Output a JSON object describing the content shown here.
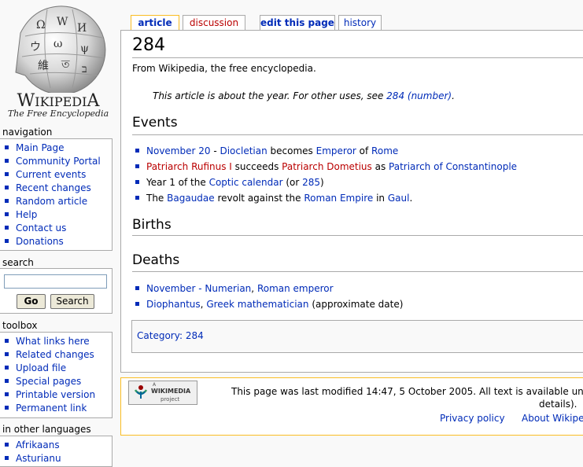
{
  "logo": {
    "wordmark_big1": "W",
    "wordmark_small1": "IKIPEDI",
    "wordmark_big2": "A",
    "tagline": "The Free Encyclopedia"
  },
  "navigation": {
    "heading": "navigation",
    "items": [
      "Main Page",
      "Community Portal",
      "Current events",
      "Recent changes",
      "Random article",
      "Help",
      "Contact us",
      "Donations"
    ]
  },
  "search": {
    "heading": "search",
    "value": "",
    "go_label": "Go",
    "search_label": "Search"
  },
  "toolbox": {
    "heading": "toolbox",
    "items": [
      "What links here",
      "Related changes",
      "Upload file",
      "Special pages",
      "Printable version",
      "Permanent link"
    ]
  },
  "languages": {
    "heading": "in other languages",
    "items": [
      "Afrikaans",
      "Asturianu"
    ]
  },
  "tabs": {
    "article": "article",
    "discussion": "discussion",
    "edit": "edit this page",
    "history": "history"
  },
  "article": {
    "title": "284",
    "subtitle": "From Wikipedia, the free encyclopedia.",
    "dablink": {
      "pre": "This article is about the year. For other uses, see ",
      "link": "284 (number)",
      "post": "."
    },
    "events_heading": "Events",
    "events": [
      {
        "a": "November 20",
        "b": " - ",
        "c": "Diocletian",
        "d": " becomes ",
        "e": "Emperor",
        "f": " of ",
        "g": "Rome"
      },
      {
        "a": "Patriarch Rufinus I",
        "b": " succeeds ",
        "c": "Patriarch Dometius",
        "d": " as ",
        "e": "Patriarch of Constantinople"
      },
      {
        "a": "Year 1 of the ",
        "b": "Coptic calendar",
        "c": " (or ",
        "d": "285",
        "e": ")"
      },
      {
        "a": "The ",
        "b": "Bagaudae",
        "c": " revolt against the ",
        "d": "Roman Empire",
        "e": " in ",
        "f": "Gaul",
        "g": "."
      }
    ],
    "births_heading": "Births",
    "deaths_heading": "Deaths",
    "deaths": [
      {
        "a": "November",
        "b": " - ",
        "c": "Numerian",
        "d": ", ",
        "e": "Roman emperor"
      },
      {
        "a": "Diophantus",
        "b": ", ",
        "c": "Greek mathematician",
        "d": " (approximate date)"
      }
    ],
    "category_label": "Category",
    "category_sep": ": ",
    "category_value": "284"
  },
  "footer": {
    "badge_small": "A",
    "badge_main": "WIKIMEDIA",
    "badge_sub": "project",
    "lastmod": "This page was last modified 14:47, 5 October 2005.",
    "license": "All text is available under",
    "license2": "details).",
    "privacy": "Privacy policy",
    "about": "About Wikiped"
  },
  "colors": {
    "link": "#002bb8",
    "redlink": "#ba0000",
    "tab_selected_border": "#fabd23"
  }
}
